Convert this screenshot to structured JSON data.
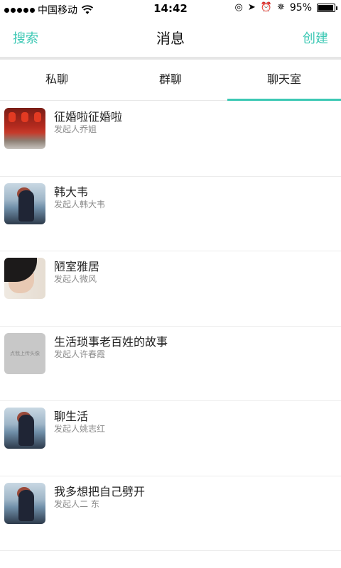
{
  "status_bar": {
    "carrier": "中国移动",
    "time": "14:42",
    "battery": "95%",
    "battery_level": 0.95
  },
  "nav": {
    "left": "搜索",
    "title": "消息",
    "right": "创建"
  },
  "tabs": [
    {
      "label": "私聊"
    },
    {
      "label": "群聊"
    },
    {
      "label": "聊天室",
      "active": true
    }
  ],
  "colors": {
    "accent": "#3cc8b4"
  },
  "rooms": [
    {
      "title": "征婚啦征婚啦",
      "sub": "发起人乔姐"
    },
    {
      "title": "韩大韦",
      "sub": "发起人韩大韦"
    },
    {
      "title": "陋室雅居",
      "sub": "发起人微风"
    },
    {
      "title": "生活琐事老百姓的故事",
      "sub": "发起人许春霞",
      "placeholder": "点我上传头像"
    },
    {
      "title": "聊生活",
      "sub": "发起人姚志红"
    },
    {
      "title": "我多想把自己劈开",
      "sub": "发起人二 东"
    }
  ]
}
